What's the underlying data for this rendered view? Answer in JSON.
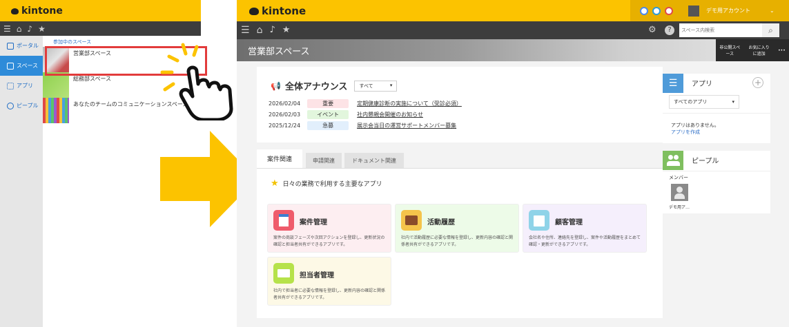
{
  "left_panel": {
    "brand": "kintone",
    "nav": [
      {
        "label": "ポータル",
        "active": false
      },
      {
        "label": "スペース",
        "active": true
      },
      {
        "label": "アプリ",
        "active": false
      },
      {
        "label": "ピープル",
        "active": false
      }
    ],
    "section_label": "参加中のスペース",
    "spaces": [
      {
        "name": "営業部スペース",
        "selected": true
      },
      {
        "name": "総務部スペース",
        "selected": false
      },
      {
        "name": "あなたのチームのコミュニケーションスペース",
        "selected": false
      }
    ]
  },
  "right_panel": {
    "brand": "kintone",
    "user_name": "デモ用アカウント",
    "search_placeholder": "スペース内検索",
    "space_title": "営業部スペース",
    "banner_actions": [
      "非公開スペース",
      "お気に入りに追加"
    ],
    "announcement": {
      "title": "全体アナウンス",
      "filter": "すべて",
      "rows": [
        {
          "date": "2026/02/04",
          "tag": "重要",
          "text": "定期健康診断の実施について（受診必須）"
        },
        {
          "date": "2026/02/03",
          "tag": "イベント",
          "text": "社内懇親会開催のお知らせ"
        },
        {
          "date": "2025/12/24",
          "tag": "急募",
          "text": "展示会当日の運営サポートメンバー募集"
        }
      ]
    },
    "tabs": [
      "案件関連",
      "申請関連",
      "ドキュメント関連"
    ],
    "apps_section_title": "日々の業務で利用する主要なアプリ",
    "apps": [
      {
        "title": "案件管理",
        "desc": "案件の商談フェーズや次回アクションを登録し、更新状況の確認と担当者共有ができるアプリです。"
      },
      {
        "title": "活動履歴",
        "desc": "社内で活動履歴に必要な情報を登録し、更新内容の確認と関係者共有ができるアプリです。"
      },
      {
        "title": "顧客管理",
        "desc": "会社名や住所、連絡先を登録し、案件や活動履歴をまとめて確認・更新ができるアプリです。"
      },
      {
        "title": "担当者管理",
        "desc": "社内で担当者に必要な情報を登録し、更新内容の確認と関係者共有ができるアプリです。"
      }
    ],
    "sidebar": {
      "apps_title": "アプリ",
      "apps_filter": "すべてのアプリ",
      "no_apps": "アプリはありません。",
      "create_app": "アプリを作成",
      "people_title": "ピープル",
      "members_label": "メンバー",
      "member_name": "デモ用ア…"
    }
  },
  "colors": {
    "kintone_yellow": "#fcc300",
    "selection_red": "#e23b3b",
    "link_blue": "#2e6fc7",
    "arrow_yellow": "#fcc300"
  }
}
